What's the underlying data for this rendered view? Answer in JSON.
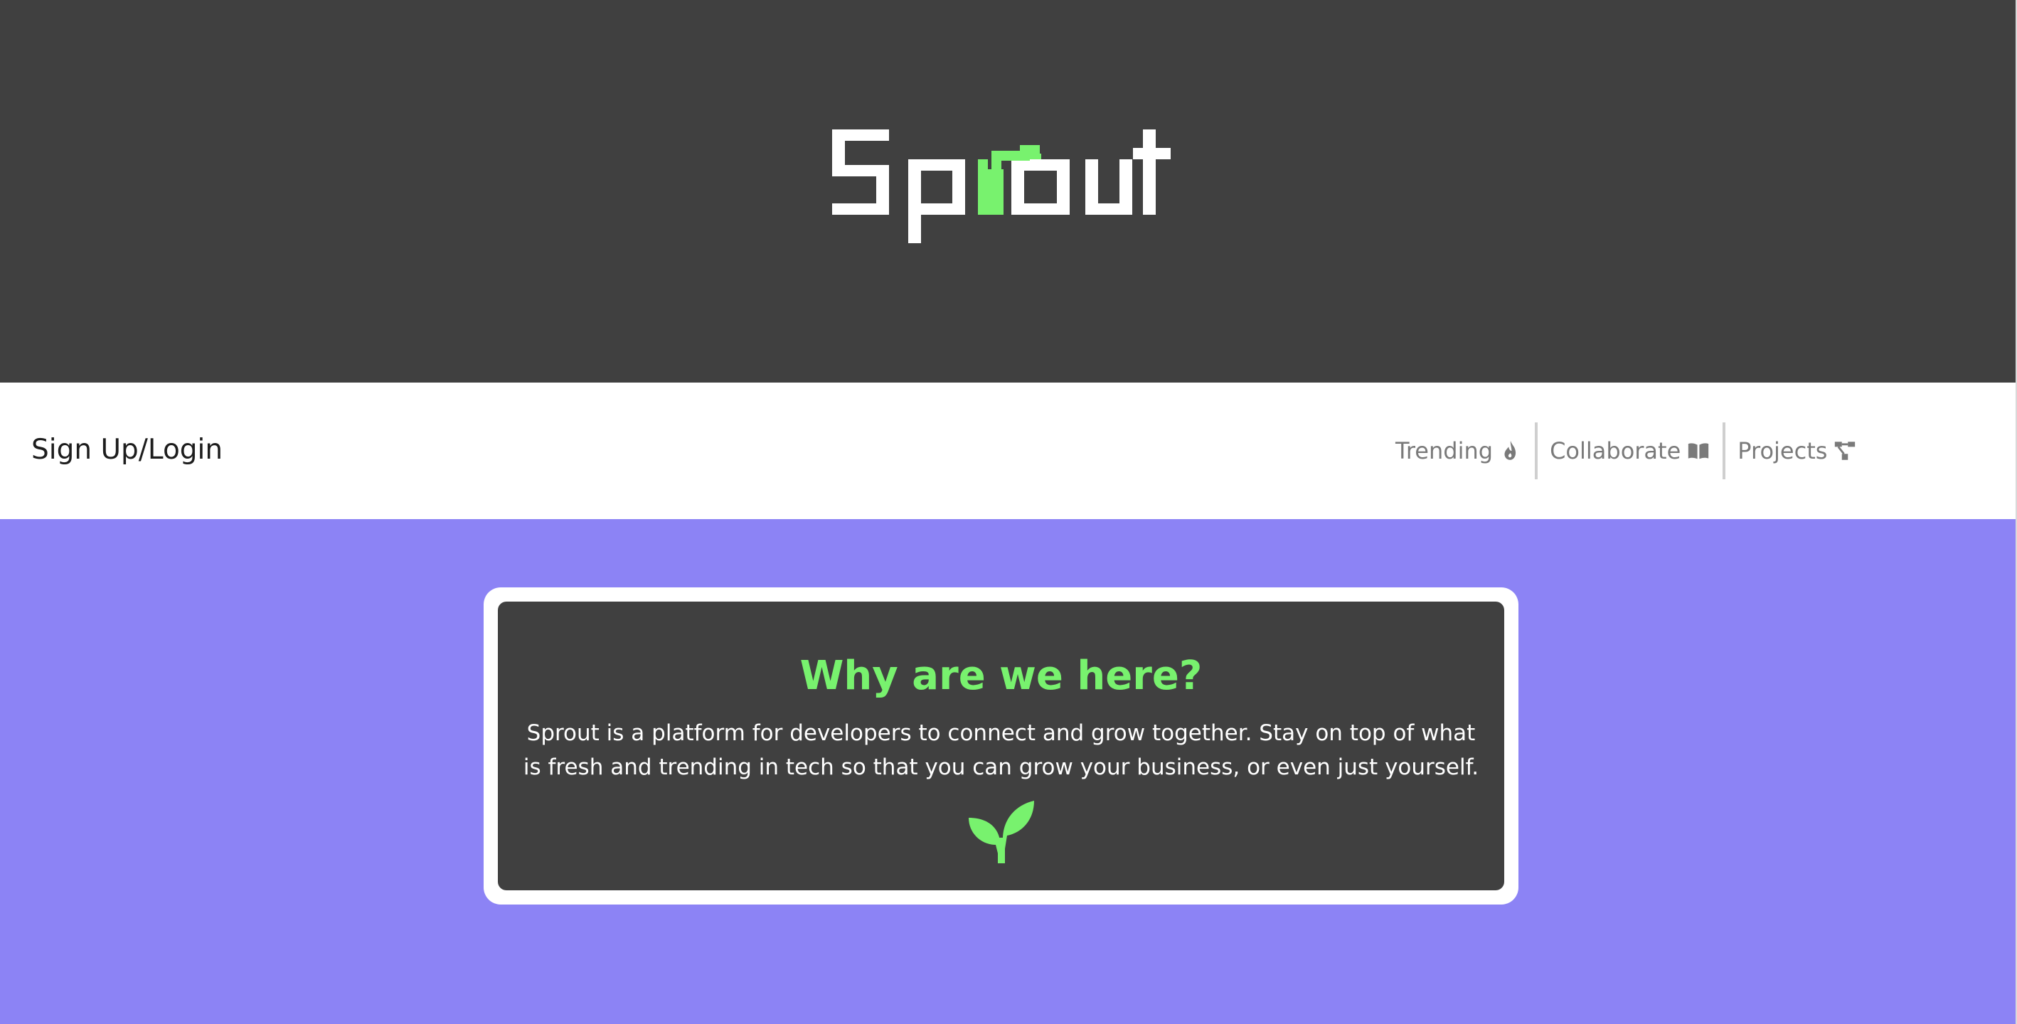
{
  "hero": {
    "logo_text": "Sprout",
    "background_color": "#404040",
    "logo_primary_color": "#ffffff",
    "logo_accent_color": "#78f26e"
  },
  "navbar": {
    "signup_label": "Sign Up/Login",
    "links": [
      {
        "label": "Trending",
        "icon": "flame-icon"
      },
      {
        "label": "Collaborate",
        "icon": "book-open-icon"
      },
      {
        "label": "Projects",
        "icon": "project-tree-icon"
      }
    ],
    "link_color": "#7a7a7a"
  },
  "info_card": {
    "title": "Why are we here?",
    "body": "Sprout is a platform for developers to connect and grow together. Stay on top of what is fresh and trending in tech so that you can grow your business, or even just yourself.",
    "icon": "sprout-icon",
    "title_color": "#78f26e",
    "card_color": "#404040"
  },
  "page": {
    "background_color": "#8c83f5"
  }
}
